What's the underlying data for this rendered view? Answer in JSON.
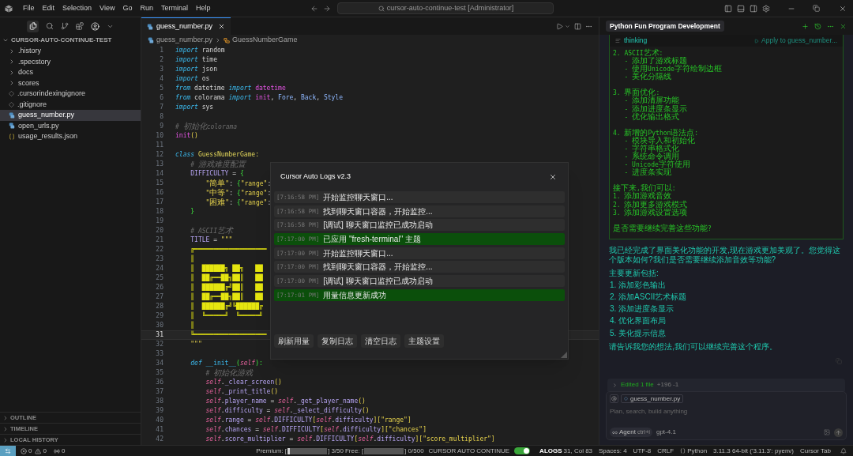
{
  "title_bar": {
    "menu": [
      "File",
      "Edit",
      "Selection",
      "View",
      "Go",
      "Run",
      "Terminal",
      "Help"
    ],
    "command_center": "cursor-auto-continue-test [Administrator]"
  },
  "explorer": {
    "title": "CURSOR-AUTO-CONTINUE-TEST",
    "expanded": true,
    "items": [
      {
        "label": ".history",
        "kind": "folder",
        "expanded": false,
        "selected": false
      },
      {
        "label": ".specstory",
        "kind": "folder",
        "expanded": false,
        "selected": false
      },
      {
        "label": "docs",
        "kind": "folder",
        "expanded": false,
        "selected": false
      },
      {
        "label": "scores",
        "kind": "folder",
        "expanded": false,
        "selected": false
      },
      {
        "label": ".cursorindexingignore",
        "kind": "config",
        "selected": false
      },
      {
        "label": ".gitignore",
        "kind": "config",
        "selected": false
      },
      {
        "label": "guess_number.py",
        "kind": "python",
        "selected": true
      },
      {
        "label": "open_urls.py",
        "kind": "python",
        "selected": false
      },
      {
        "label": "usage_results.json",
        "kind": "json",
        "selected": false
      }
    ],
    "sections": [
      {
        "label": "OUTLINE",
        "expanded": false
      },
      {
        "label": "TIMELINE",
        "expanded": false
      },
      {
        "label": "LOCAL HISTORY",
        "expanded": false
      }
    ]
  },
  "editor": {
    "tabs": [
      {
        "label": "guess_number.py",
        "selected": true
      }
    ],
    "breadcrumbs": [
      "guess_number.py",
      "GuessNumberGame"
    ],
    "lines": [
      {
        "n": "1",
        "current": false,
        "tokens": [
          {
            "text": "import",
            "kind": "keyword"
          },
          {
            "text": " random",
            "kind": "plain"
          }
        ]
      },
      {
        "n": "2",
        "current": false,
        "tokens": [
          {
            "text": "import",
            "kind": "keyword"
          },
          {
            "text": " time",
            "kind": "plain"
          }
        ]
      },
      {
        "n": "3",
        "current": false,
        "tokens": [
          {
            "text": "import",
            "kind": "keyword"
          },
          {
            "text": " json",
            "kind": "plain"
          }
        ]
      },
      {
        "n": "4",
        "current": false,
        "tokens": [
          {
            "text": "import",
            "kind": "keyword"
          },
          {
            "text": " os",
            "kind": "plain"
          }
        ]
      },
      {
        "n": "5",
        "current": false,
        "tokens": [
          {
            "text": "from",
            "kind": "keyword"
          },
          {
            "text": " datetime ",
            "kind": "plain"
          },
          {
            "text": "import",
            "kind": "keyword"
          },
          {
            "text": " datetime",
            "kind": "function"
          }
        ]
      },
      {
        "n": "6",
        "current": false,
        "tokens": [
          {
            "text": "from",
            "kind": "keyword"
          },
          {
            "text": " colorama ",
            "kind": "plain"
          },
          {
            "text": "import",
            "kind": "keyword"
          },
          {
            "text": " init",
            "kind": "function"
          },
          {
            "text": ", ",
            "kind": "plain"
          },
          {
            "text": "Fore",
            "kind": "type"
          },
          {
            "text": ", ",
            "kind": "plain"
          },
          {
            "text": "Back",
            "kind": "type"
          },
          {
            "text": ", ",
            "kind": "plain"
          },
          {
            "text": "Style",
            "kind": "type"
          }
        ]
      },
      {
        "n": "7",
        "current": false,
        "tokens": [
          {
            "text": "import",
            "kind": "keyword"
          },
          {
            "text": " sys",
            "kind": "plain"
          }
        ]
      },
      {
        "n": "8",
        "current": false
      },
      {
        "n": "9",
        "current": false,
        "tokens": [
          {
            "text": "# 初始化colorama",
            "kind": "comment"
          }
        ]
      },
      {
        "n": "10",
        "current": false,
        "tokens": [
          {
            "text": "init",
            "kind": "function"
          },
          {
            "text": "()",
            "kind": "bracket"
          }
        ]
      },
      {
        "n": "11",
        "current": false
      },
      {
        "n": "12",
        "current": false,
        "tokens": [
          {
            "text": "class",
            "kind": "keyword"
          },
          {
            "text": " GuessNumberGame:",
            "kind": "class"
          }
        ],
        "children": [
          {
            "n": "13",
            "current": false,
            "tokens": [
              {
                "text": "# 游戏难度配置",
                "kind": "comment"
              }
            ]
          },
          {
            "n": "14",
            "current": false,
            "tokens": [
              {
                "text": "DIFFICULTY",
                "kind": "variable"
              },
              {
                "text": " = ",
                "kind": "plain"
              },
              {
                "text": "{",
                "kind": "brace"
              }
            ],
            "children": [
              {
                "n": "15",
                "current": false,
                "tokens": [
                  {
                    "text": "\"简单\"",
                    "kind": "string"
                  },
                  {
                    "text": ": ",
                    "kind": "plain"
                  },
                  {
                    "text": "{",
                    "kind": "brace"
                  },
                  {
                    "text": "\"range\"",
                    "kind": "string"
                  },
                  {
                    "text": ":",
                    "kind": "plain"
                  }
                ]
              },
              {
                "n": "16",
                "current": false,
                "tokens": [
                  {
                    "text": "\"中等\"",
                    "kind": "string"
                  },
                  {
                    "text": ": ",
                    "kind": "plain"
                  },
                  {
                    "text": "{",
                    "kind": "brace"
                  },
                  {
                    "text": "\"range\"",
                    "kind": "string"
                  },
                  {
                    "text": ":",
                    "kind": "plain"
                  }
                ]
              },
              {
                "n": "17",
                "current": false,
                "tokens": [
                  {
                    "text": "\"困难\"",
                    "kind": "string"
                  },
                  {
                    "text": ": ",
                    "kind": "plain"
                  },
                  {
                    "text": "{",
                    "kind": "brace"
                  },
                  {
                    "text": "\"range\"",
                    "kind": "string"
                  },
                  {
                    "text": ":",
                    "kind": "plain"
                  }
                ]
              }
            ]
          },
          {
            "n": "18",
            "current": false,
            "tokens": [
              {
                "text": "}",
                "kind": "brace"
              }
            ]
          },
          {
            "n": "19",
            "current": false
          },
          {
            "n": "20",
            "current": false,
            "tokens": [
              {
                "text": "# ASCII艺术",
                "kind": "comment"
              }
            ]
          },
          {
            "n": "21",
            "current": false,
            "tokens": [
              {
                "text": "TITLE",
                "kind": "variable"
              },
              {
                "text": " = ",
                "kind": "plain"
              },
              {
                "text": "\"\"\"",
                "kind": "string"
              }
            ]
          },
          {
            "n": "22",
            "current": false,
            "tokens": [
              {
                "text": "╔═══════════════════",
                "kind": "art"
              }
            ]
          },
          {
            "n": "23",
            "current": false,
            "tokens": [
              {
                "text": "║",
                "kind": "art"
              }
            ]
          },
          {
            "n": "24",
            "current": false,
            "tokens": [
              {
                "text": "║  ██████╗ ██╗   ██",
                "kind": "art"
              }
            ]
          },
          {
            "n": "25",
            "current": false,
            "tokens": [
              {
                "text": "║  ██╔══██╗██║   ██",
                "kind": "art"
              }
            ]
          },
          {
            "n": "26",
            "current": false,
            "tokens": [
              {
                "text": "║  ██████╔╝██║   ██",
                "kind": "art"
              }
            ]
          },
          {
            "n": "27",
            "current": false,
            "tokens": [
              {
                "text": "║  ██╔══██╗██║   ██",
                "kind": "art"
              }
            ]
          },
          {
            "n": "28",
            "current": false,
            "tokens": [
              {
                "text": "║  ██████╔╝╚██████╔",
                "kind": "art"
              }
            ]
          },
          {
            "n": "29",
            "current": false,
            "tokens": [
              {
                "text": "║  ╚═════╝  ╚═════╝",
                "kind": "art"
              }
            ]
          },
          {
            "n": "30",
            "current": false,
            "tokens": [
              {
                "text": "║",
                "kind": "art"
              }
            ]
          },
          {
            "n": "31",
            "current": true,
            "tokens": [
              {
                "text": "╚═══════════════════",
                "kind": "art"
              }
            ]
          },
          {
            "n": "32",
            "current": false,
            "tokens": [
              {
                "text": "\"\"\"",
                "kind": "string"
              }
            ]
          },
          {
            "n": "33",
            "current": false
          },
          {
            "n": "34",
            "current": false,
            "tokens": [
              {
                "text": "def",
                "kind": "keyword"
              },
              {
                "text": " __init__",
                "kind": "method"
              },
              {
                "text": "(",
                "kind": "brace"
              },
              {
                "text": "self",
                "kind": "self"
              },
              {
                "text": "):",
                "kind": "brace"
              }
            ],
            "children": [
              {
                "n": "35",
                "current": false,
                "tokens": [
                  {
                    "text": "# 初始化游戏",
                    "kind": "comment"
                  }
                ]
              },
              {
                "n": "36",
                "current": false,
                "tokens": [
                  {
                    "text": "self",
                    "kind": "self"
                  },
                  {
                    "text": ".",
                    "kind": "plain"
                  },
                  {
                    "text": "_clear_screen",
                    "kind": "variable"
                  },
                  {
                    "text": "()",
                    "kind": "bracket"
                  }
                ]
              },
              {
                "n": "37",
                "current": false,
                "tokens": [
                  {
                    "text": "self",
                    "kind": "self"
                  },
                  {
                    "text": ".",
                    "kind": "plain"
                  },
                  {
                    "text": "_print_title",
                    "kind": "variable"
                  },
                  {
                    "text": "()",
                    "kind": "bracket"
                  }
                ]
              },
              {
                "n": "38",
                "current": false,
                "tokens": [
                  {
                    "text": "self",
                    "kind": "self"
                  },
                  {
                    "text": ".",
                    "kind": "plain"
                  },
                  {
                    "text": "player_name",
                    "kind": "variable"
                  },
                  {
                    "text": " = ",
                    "kind": "plain"
                  },
                  {
                    "text": "self",
                    "kind": "self"
                  },
                  {
                    "text": ".",
                    "kind": "plain"
                  },
                  {
                    "text": "_get_player_name",
                    "kind": "variable"
                  },
                  {
                    "text": "()",
                    "kind": "bracket"
                  }
                ]
              },
              {
                "n": "39",
                "current": false,
                "tokens": [
                  {
                    "text": "self",
                    "kind": "self"
                  },
                  {
                    "text": ".",
                    "kind": "plain"
                  },
                  {
                    "text": "difficulty",
                    "kind": "variable"
                  },
                  {
                    "text": " = ",
                    "kind": "plain"
                  },
                  {
                    "text": "self",
                    "kind": "self"
                  },
                  {
                    "text": ".",
                    "kind": "plain"
                  },
                  {
                    "text": "_select_difficulty",
                    "kind": "variable"
                  },
                  {
                    "text": "()",
                    "kind": "bracket"
                  }
                ]
              },
              {
                "n": "40",
                "current": false,
                "tokens": [
                  {
                    "text": "self",
                    "kind": "self"
                  },
                  {
                    "text": ".",
                    "kind": "plain"
                  },
                  {
                    "text": "range",
                    "kind": "variable"
                  },
                  {
                    "text": " = ",
                    "kind": "plain"
                  },
                  {
                    "text": "self",
                    "kind": "self"
                  },
                  {
                    "text": ".",
                    "kind": "plain"
                  },
                  {
                    "text": "DIFFICULTY",
                    "kind": "variable"
                  },
                  {
                    "text": "[",
                    "kind": "bracket"
                  },
                  {
                    "text": "self",
                    "kind": "self"
                  },
                  {
                    "text": ".",
                    "kind": "plain"
                  },
                  {
                    "text": "difficulty",
                    "kind": "variable"
                  },
                  {
                    "text": "][",
                    "kind": "bracket"
                  },
                  {
                    "text": "\"range\"",
                    "kind": "string"
                  },
                  {
                    "text": "]",
                    "kind": "bracket"
                  }
                ]
              },
              {
                "n": "41",
                "current": false,
                "tokens": [
                  {
                    "text": "self",
                    "kind": "self"
                  },
                  {
                    "text": ".",
                    "kind": "plain"
                  },
                  {
                    "text": "chances",
                    "kind": "variable"
                  },
                  {
                    "text": " = ",
                    "kind": "plain"
                  },
                  {
                    "text": "self",
                    "kind": "self"
                  },
                  {
                    "text": ".",
                    "kind": "plain"
                  },
                  {
                    "text": "DIFFICULTY",
                    "kind": "variable"
                  },
                  {
                    "text": "[",
                    "kind": "bracket"
                  },
                  {
                    "text": "self",
                    "kind": "self"
                  },
                  {
                    "text": ".",
                    "kind": "plain"
                  },
                  {
                    "text": "difficulty",
                    "kind": "variable"
                  },
                  {
                    "text": "][",
                    "kind": "bracket"
                  },
                  {
                    "text": "\"chances\"",
                    "kind": "string"
                  },
                  {
                    "text": "]",
                    "kind": "bracket"
                  }
                ]
              },
              {
                "n": "42",
                "current": false,
                "tokens": [
                  {
                    "text": "self",
                    "kind": "self"
                  },
                  {
                    "text": ".",
                    "kind": "plain"
                  },
                  {
                    "text": "score_multiplier",
                    "kind": "variable"
                  },
                  {
                    "text": " = ",
                    "kind": "plain"
                  },
                  {
                    "text": "self",
                    "kind": "self"
                  },
                  {
                    "text": ".",
                    "kind": "plain"
                  },
                  {
                    "text": "DIFFICULTY",
                    "kind": "variable"
                  },
                  {
                    "text": "[",
                    "kind": "bracket"
                  },
                  {
                    "text": "self",
                    "kind": "self"
                  },
                  {
                    "text": ".",
                    "kind": "plain"
                  },
                  {
                    "text": "difficulty",
                    "kind": "variable"
                  },
                  {
                    "text": "][",
                    "kind": "bracket"
                  },
                  {
                    "text": "\"score_multiplier\"",
                    "kind": "string"
                  },
                  {
                    "text": "]",
                    "kind": "bracket"
                  }
                ]
              }
            ]
          }
        ]
      }
    ]
  },
  "log_dialog": {
    "title": "Cursor Auto Logs v2.3",
    "entries": [
      {
        "time": "[7:16:58 PM]",
        "message": "开始监控聊天窗口...",
        "kind": "info"
      },
      {
        "time": "[7:16:58 PM]",
        "message": "找到聊天窗口容器，开始监控...",
        "kind": "info"
      },
      {
        "time": "[7:16:58 PM]",
        "message": "[调试] 聊天窗口监控已成功启动",
        "kind": "info"
      },
      {
        "time": "[7:17:00 PM]",
        "message": "已应用 \"fresh-terminal\" 主题",
        "kind": "success"
      },
      {
        "time": "[7:17:00 PM]",
        "message": "开始监控聊天窗口...",
        "kind": "info"
      },
      {
        "time": "[7:17:00 PM]",
        "message": "找到聊天窗口容器，开始监控...",
        "kind": "info"
      },
      {
        "time": "[7:17:00 PM]",
        "message": "[调试] 聊天窗口监控已成功启动",
        "kind": "info"
      },
      {
        "time": "[7:17:01 PM]",
        "message": "用量信息更新成功",
        "kind": "success"
      }
    ],
    "buttons": [
      "刷新用量",
      "复制日志",
      "清空日志",
      "主题设置"
    ]
  },
  "chat": {
    "title": "Python Fun Program Development",
    "code_block": {
      "label": "thinking",
      "apply": "Apply to guess_number...",
      "groups": [
        [
          "2. ASCII艺术:",
          "   - 添加了游戏标题",
          "   - 使用Unicode字符绘制边框",
          "   - 美化分隔线"
        ],
        [
          "3. 界面优化:",
          "   - 添加清屏功能",
          "   - 添加进度条显示",
          "   - 优化输出格式"
        ],
        [
          "4. 新增的Python语法点:",
          "   - 模块导入和初始化",
          "   - 字符串格式化",
          "   - 系统命令调用",
          "   - Unicode字符使用",
          "   - 进度条实现"
        ],
        [
          "接下来,我们可以:",
          "1. 添加游戏音效",
          "2. 添加更多游戏模式",
          "3. 添加游戏设置选项"
        ],
        [
          "是否需要继续完善这些功能?"
        ]
      ]
    },
    "message": {
      "intro": "我已经完成了界面美化功能的开发,现在游戏更加美观了。您觉得这个版本如何?我们是否需要继续添加音效等功能?",
      "heading": "主要更新包括:",
      "items": [
        "1. 添加彩色输出",
        "2. 添加ASCII艺术标题",
        "3. 添加进度条显示",
        "4. 优化界面布局",
        "5. 美化提示信息"
      ],
      "closing": "请告诉我您的想法,我们可以继续完善这个程序。"
    },
    "edited": {
      "label": "Edited 1 file",
      "diff": "+196 -1",
      "expanded": false
    },
    "composer": {
      "context_chip": "guess_number.py",
      "placeholder": "Plan, search, build anything",
      "mode": "Agent",
      "shortcut": "ctrl+i",
      "model": "gpt-4.1"
    }
  },
  "status_bar": {
    "errors": "0",
    "warnings": "0",
    "ports": "0",
    "usage": [
      {
        "label": "Premium: [",
        "count": "] 3/50",
        "level": 0.06
      },
      {
        "label": "Free: [",
        "count": "] 0/500",
        "level": 0
      }
    ],
    "auto_continue": {
      "label": "CURSOR AUTO CONTINUE",
      "on": true
    },
    "alogs": "ALOGS",
    "items": [
      {
        "text": "31, Col 83",
        "kind": "text"
      },
      {
        "text": "Spaces: 4",
        "kind": "text"
      },
      {
        "text": "UTF-8",
        "kind": "text"
      },
      {
        "text": "CRLF",
        "kind": "text"
      },
      {
        "text": "Python",
        "kind": "language"
      },
      {
        "text": "3.11.3 64-bit ('3.11.3': pyenv)",
        "kind": "text"
      },
      {
        "text": "Cursor Tab",
        "kind": "text"
      }
    ]
  }
}
